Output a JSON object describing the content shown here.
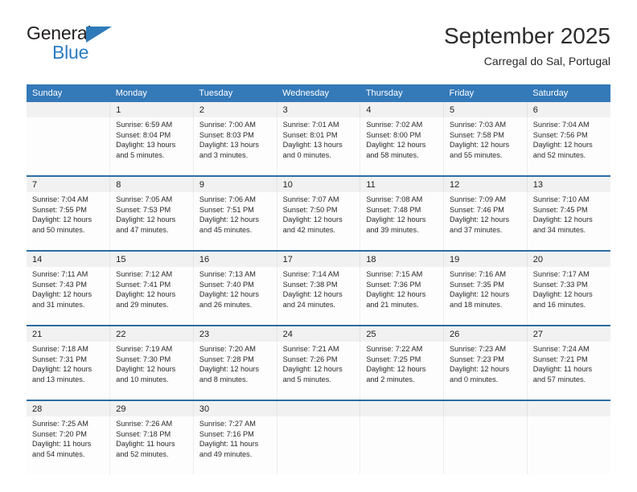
{
  "brand": {
    "line1": "General",
    "line2": "Blue",
    "triangle_color": "#2e7ab8"
  },
  "header": {
    "title": "September 2025",
    "subtitle": "Carregal do Sal, Portugal"
  },
  "colors": {
    "header_blue": "#3479b8",
    "separator_blue": "#2e6da4",
    "daynum_bg": "#f1f1f1",
    "cell_bg": "#fdfdfd"
  },
  "weekday_headers": [
    "Sunday",
    "Monday",
    "Tuesday",
    "Wednesday",
    "Thursday",
    "Friday",
    "Saturday"
  ],
  "weeks": [
    [
      {
        "day": "",
        "lines": []
      },
      {
        "day": "1",
        "lines": [
          "Sunrise: 6:59 AM",
          "Sunset: 8:04 PM",
          "Daylight: 13 hours",
          "and 5 minutes."
        ]
      },
      {
        "day": "2",
        "lines": [
          "Sunrise: 7:00 AM",
          "Sunset: 8:03 PM",
          "Daylight: 13 hours",
          "and 3 minutes."
        ]
      },
      {
        "day": "3",
        "lines": [
          "Sunrise: 7:01 AM",
          "Sunset: 8:01 PM",
          "Daylight: 13 hours",
          "and 0 minutes."
        ]
      },
      {
        "day": "4",
        "lines": [
          "Sunrise: 7:02 AM",
          "Sunset: 8:00 PM",
          "Daylight: 12 hours",
          "and 58 minutes."
        ]
      },
      {
        "day": "5",
        "lines": [
          "Sunrise: 7:03 AM",
          "Sunset: 7:58 PM",
          "Daylight: 12 hours",
          "and 55 minutes."
        ]
      },
      {
        "day": "6",
        "lines": [
          "Sunrise: 7:04 AM",
          "Sunset: 7:56 PM",
          "Daylight: 12 hours",
          "and 52 minutes."
        ]
      }
    ],
    [
      {
        "day": "7",
        "lines": [
          "Sunrise: 7:04 AM",
          "Sunset: 7:55 PM",
          "Daylight: 12 hours",
          "and 50 minutes."
        ]
      },
      {
        "day": "8",
        "lines": [
          "Sunrise: 7:05 AM",
          "Sunset: 7:53 PM",
          "Daylight: 12 hours",
          "and 47 minutes."
        ]
      },
      {
        "day": "9",
        "lines": [
          "Sunrise: 7:06 AM",
          "Sunset: 7:51 PM",
          "Daylight: 12 hours",
          "and 45 minutes."
        ]
      },
      {
        "day": "10",
        "lines": [
          "Sunrise: 7:07 AM",
          "Sunset: 7:50 PM",
          "Daylight: 12 hours",
          "and 42 minutes."
        ]
      },
      {
        "day": "11",
        "lines": [
          "Sunrise: 7:08 AM",
          "Sunset: 7:48 PM",
          "Daylight: 12 hours",
          "and 39 minutes."
        ]
      },
      {
        "day": "12",
        "lines": [
          "Sunrise: 7:09 AM",
          "Sunset: 7:46 PM",
          "Daylight: 12 hours",
          "and 37 minutes."
        ]
      },
      {
        "day": "13",
        "lines": [
          "Sunrise: 7:10 AM",
          "Sunset: 7:45 PM",
          "Daylight: 12 hours",
          "and 34 minutes."
        ]
      }
    ],
    [
      {
        "day": "14",
        "lines": [
          "Sunrise: 7:11 AM",
          "Sunset: 7:43 PM",
          "Daylight: 12 hours",
          "and 31 minutes."
        ]
      },
      {
        "day": "15",
        "lines": [
          "Sunrise: 7:12 AM",
          "Sunset: 7:41 PM",
          "Daylight: 12 hours",
          "and 29 minutes."
        ]
      },
      {
        "day": "16",
        "lines": [
          "Sunrise: 7:13 AM",
          "Sunset: 7:40 PM",
          "Daylight: 12 hours",
          "and 26 minutes."
        ]
      },
      {
        "day": "17",
        "lines": [
          "Sunrise: 7:14 AM",
          "Sunset: 7:38 PM",
          "Daylight: 12 hours",
          "and 24 minutes."
        ]
      },
      {
        "day": "18",
        "lines": [
          "Sunrise: 7:15 AM",
          "Sunset: 7:36 PM",
          "Daylight: 12 hours",
          "and 21 minutes."
        ]
      },
      {
        "day": "19",
        "lines": [
          "Sunrise: 7:16 AM",
          "Sunset: 7:35 PM",
          "Daylight: 12 hours",
          "and 18 minutes."
        ]
      },
      {
        "day": "20",
        "lines": [
          "Sunrise: 7:17 AM",
          "Sunset: 7:33 PM",
          "Daylight: 12 hours",
          "and 16 minutes."
        ]
      }
    ],
    [
      {
        "day": "21",
        "lines": [
          "Sunrise: 7:18 AM",
          "Sunset: 7:31 PM",
          "Daylight: 12 hours",
          "and 13 minutes."
        ]
      },
      {
        "day": "22",
        "lines": [
          "Sunrise: 7:19 AM",
          "Sunset: 7:30 PM",
          "Daylight: 12 hours",
          "and 10 minutes."
        ]
      },
      {
        "day": "23",
        "lines": [
          "Sunrise: 7:20 AM",
          "Sunset: 7:28 PM",
          "Daylight: 12 hours",
          "and 8 minutes."
        ]
      },
      {
        "day": "24",
        "lines": [
          "Sunrise: 7:21 AM",
          "Sunset: 7:26 PM",
          "Daylight: 12 hours",
          "and 5 minutes."
        ]
      },
      {
        "day": "25",
        "lines": [
          "Sunrise: 7:22 AM",
          "Sunset: 7:25 PM",
          "Daylight: 12 hours",
          "and 2 minutes."
        ]
      },
      {
        "day": "26",
        "lines": [
          "Sunrise: 7:23 AM",
          "Sunset: 7:23 PM",
          "Daylight: 12 hours",
          "and 0 minutes."
        ]
      },
      {
        "day": "27",
        "lines": [
          "Sunrise: 7:24 AM",
          "Sunset: 7:21 PM",
          "Daylight: 11 hours",
          "and 57 minutes."
        ]
      }
    ],
    [
      {
        "day": "28",
        "lines": [
          "Sunrise: 7:25 AM",
          "Sunset: 7:20 PM",
          "Daylight: 11 hours",
          "and 54 minutes."
        ]
      },
      {
        "day": "29",
        "lines": [
          "Sunrise: 7:26 AM",
          "Sunset: 7:18 PM",
          "Daylight: 11 hours",
          "and 52 minutes."
        ]
      },
      {
        "day": "30",
        "lines": [
          "Sunrise: 7:27 AM",
          "Sunset: 7:16 PM",
          "Daylight: 11 hours",
          "and 49 minutes."
        ]
      },
      {
        "day": "",
        "lines": []
      },
      {
        "day": "",
        "lines": []
      },
      {
        "day": "",
        "lines": []
      },
      {
        "day": "",
        "lines": []
      }
    ]
  ]
}
